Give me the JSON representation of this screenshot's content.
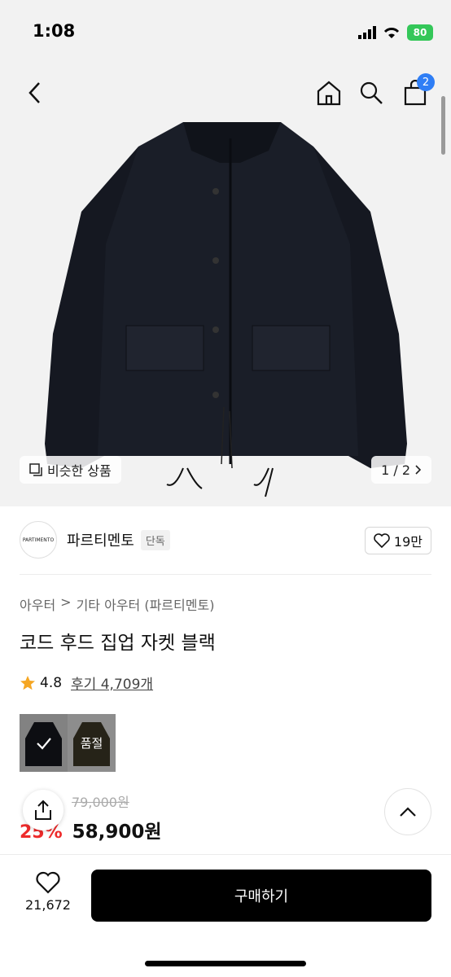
{
  "status": {
    "time": "1:08",
    "battery": "80"
  },
  "nav": {
    "cart_count": "2"
  },
  "image": {
    "similar_label": "비슷한 상품",
    "pager": "1 / 2"
  },
  "brand": {
    "logo_text": "PARTIMENTO",
    "name": "파르티멘토",
    "tag": "단독",
    "likes": "19만"
  },
  "product": {
    "breadcrumb_1": "아우터",
    "breadcrumb_2": "기타 아우터 (파르티멘토)",
    "title": "코드 후드 집업 자켓 블랙",
    "rating": "4.8",
    "review_label": "후기 4,709개",
    "option_soldout": "품절",
    "original_price": "79,000원",
    "discount": "25%",
    "sale_price": "58,900원"
  },
  "bottom": {
    "wish_count": "21,672",
    "buy_label": "구매하기"
  },
  "colors": {
    "accent": "#2f7ef5",
    "discount": "#ee2b2b",
    "battery": "#34c759",
    "star": "#f5a623"
  }
}
